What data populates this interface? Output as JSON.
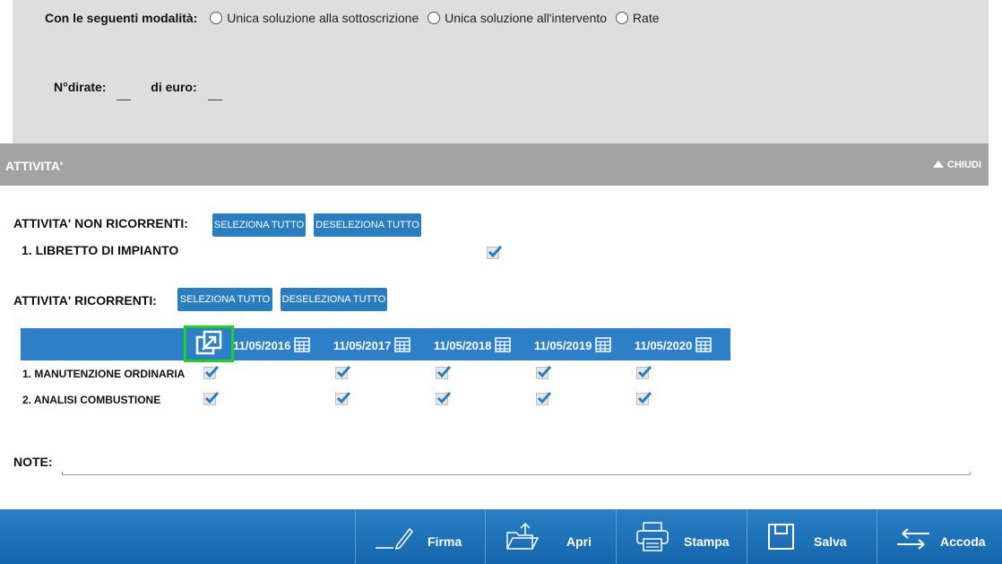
{
  "payment": {
    "label": "Con le seguenti modalità:",
    "options": [
      "Unica soluzione alla sottoscrizione",
      "Unica soluzione all'intervento",
      "Rate"
    ],
    "n_rate_label": "N°dirate:",
    "euro_label": "di euro:"
  },
  "section": {
    "title": "ATTIVITA'",
    "collapse_label": "CHIUDI"
  },
  "non_ricorrenti": {
    "label": "ATTIVITA' NON RICORRENTI:",
    "select_all": "SELEZIONA TUTTO",
    "deselect_all": "DESELEZIONA TUTTO",
    "items": [
      {
        "label": "1. LIBRETTO DI IMPIANTO",
        "checked": true
      }
    ]
  },
  "ricorrenti": {
    "label": "ATTIVITA' RICORRENTI:",
    "select_all": "SELEZIONA TUTTO",
    "deselect_all": "DESELEZIONA TUTTO",
    "dates": [
      "11/05/2016",
      "11/05/2017",
      "11/05/2018",
      "11/05/2019",
      "11/05/2020"
    ],
    "rows": [
      {
        "label": "1. MANUTENZIONE ORDINARIA",
        "checked": [
          true,
          true,
          true,
          true,
          true
        ]
      },
      {
        "label": "2. ANALISI COMBUSTIONE",
        "checked": [
          true,
          true,
          true,
          true,
          true
        ]
      }
    ]
  },
  "note": {
    "label": "NOTE:",
    "value": ""
  },
  "toolbar": {
    "firma": "Firma",
    "apri": "Apri",
    "stampa": "Stampa",
    "salva": "Salva",
    "accoda": "Accoda"
  },
  "colors": {
    "accent": "#2a7ec0",
    "highlight": "#1ed21e",
    "section_header": "#a3a3a3",
    "panel": "#dedede"
  },
  "icons": [
    "radio-icon",
    "chevron-up-icon",
    "checkbox-icon",
    "calendar-icon",
    "expand-icon",
    "pen-icon",
    "folder-open-icon",
    "printer-icon",
    "floppy-disk-icon",
    "arrows-exchange-icon"
  ]
}
